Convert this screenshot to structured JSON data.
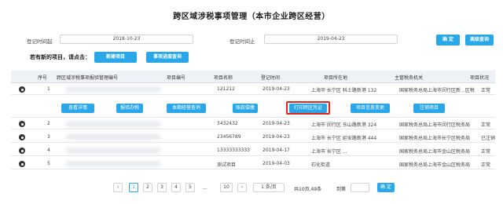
{
  "page": {
    "title": "跨区域涉税事项管理（本市企业跨区经营）"
  },
  "filters": {
    "start_label": "登记时间起",
    "start_value": "2018-10-23",
    "end_label": "登记时间止",
    "end_value": "2019-04-23",
    "confirm_label": "确 定",
    "advanced_label": "高级查询"
  },
  "hint": "若有新的项目，请点击：",
  "actions": {
    "new_project": "新建项目",
    "progress_query": "事项进度查询"
  },
  "table": {
    "headers": [
      "序号",
      "跨区域涉税事项报验管理编号",
      "项目编号",
      "项目名称",
      "登记时间",
      "项目所在地",
      "主管税务机关",
      "项目状况"
    ],
    "rows": [
      {
        "index": "1",
        "name": "121212",
        "date": "2019-04-23",
        "location": "上海市 长宁区 科土路新港 132",
        "authority": "国家税务总局上海市闵行区新...区税务局",
        "status": "正常"
      },
      {
        "index": "2",
        "name": "3432432",
        "date": "2019-04-23",
        "location": "上海市 闵行区 东山路新港 324",
        "authority": "国家税务总局上海市闵行区税务局",
        "status": "正常"
      },
      {
        "index": "3",
        "name": "23456789",
        "date": "2019-04-23",
        "location": "上海市 长宁区 延安路新港 444",
        "authority": "国家税务总局上海市长宁区税务局",
        "status": "已注销"
      },
      {
        "index": "4",
        "name": "13333333333",
        "date": "2019-04-17",
        "location": "上海市 长宁区 ...",
        "authority": "国家税务总局上海市金山区税务局",
        "status": "正常"
      },
      {
        "index": "5",
        "name": "测试项目",
        "date": "2019-04-03",
        "location": "石化街道",
        "authority": "国家税务总局上海市金山区税务局",
        "status": "正常"
      }
    ],
    "row_actions": [
      "查看详情",
      "报验办税",
      "本期经营查询",
      "账款偿缴",
      "打印跨区凭证",
      "项目信息变更",
      "注销项目"
    ]
  },
  "pagination": {
    "prev": "‹",
    "pages": [
      "1",
      "2",
      "3",
      "4",
      "5"
    ],
    "ellipsis": "...",
    "last": "10",
    "next": "›",
    "page_size": "1 条/页",
    "total": "共10页,49条",
    "goto_label": "到第",
    "confirm": "确 定"
  },
  "colors": {
    "accent": "#2aa7e8",
    "highlight": "#e0261b"
  }
}
